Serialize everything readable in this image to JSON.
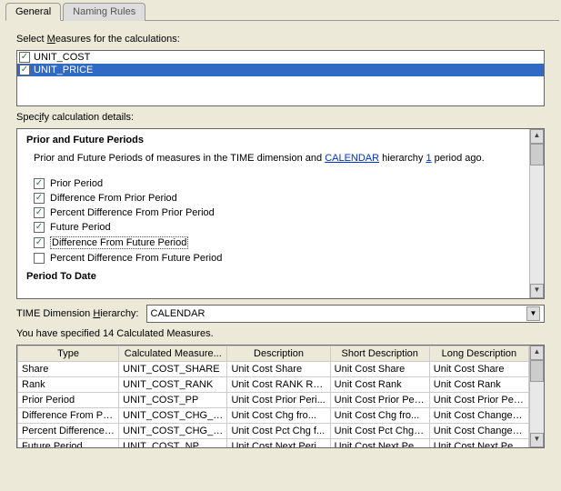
{
  "tabs": {
    "general": "General",
    "naming": "Naming Rules"
  },
  "labels": {
    "select_measures_pre": "Select ",
    "select_measures_u": "M",
    "select_measures_post": "easures for the calculations:",
    "specify_pre": "Spec",
    "specify_u": "i",
    "specify_post": "fy calculation details:",
    "dim_pre": "TIME Dimension ",
    "dim_u": "H",
    "dim_post": "ierarchy:",
    "summary": "You have specified 14 Calculated Measures."
  },
  "measures": [
    {
      "label": "UNIT_COST",
      "checked": true,
      "selected": false
    },
    {
      "label": "UNIT_PRICE",
      "checked": true,
      "selected": true
    }
  ],
  "section": {
    "title": "Prior and Future Periods",
    "text_pre": "Prior and Future Periods of measures in the  TIME  dimension and   ",
    "link1": "CALENDAR",
    "text_mid": "  hierarchy   ",
    "link2": "1",
    "text_post": " period ago.",
    "cut": "Period To Date"
  },
  "checks": [
    {
      "label": "Prior Period",
      "checked": true,
      "focused": false
    },
    {
      "label": "Difference From Prior Period",
      "checked": true,
      "focused": false
    },
    {
      "label": "Percent Difference From Prior Period",
      "checked": true,
      "focused": false
    },
    {
      "label": "Future Period",
      "checked": true,
      "focused": false
    },
    {
      "label": "Difference From Future Period",
      "checked": true,
      "focused": true
    },
    {
      "label": "Percent Difference From Future Period",
      "checked": false,
      "focused": false
    }
  ],
  "select": {
    "value": "CALENDAR"
  },
  "table": {
    "headers": [
      "Type",
      "Calculated Measure...",
      "Description",
      "Short Description",
      "Long Description"
    ],
    "rows": [
      [
        "Share",
        "UNIT_COST_SHARE",
        "Unit Cost Share",
        "Unit Cost Share",
        "Unit Cost Share"
      ],
      [
        "Rank",
        "UNIT_COST_RANK",
        "Unit Cost RANK Rank",
        "Unit Cost Rank",
        "Unit Cost Rank"
      ],
      [
        "Prior Period",
        "UNIT_COST_PP",
        "Unit Cost Prior Peri...",
        "Unit Cost Prior Peri...",
        "Unit Cost Prior Peri..."
      ],
      [
        "Difference From Pri...",
        "UNIT_COST_CHG_PP",
        "Unit Cost Chg fro...",
        "Unit Cost Chg fro...",
        "Unit Cost Change f..."
      ],
      [
        "Percent Difference ...",
        "UNIT_COST_CHG_PP",
        "Unit Cost Pct Chg f...",
        "Unit Cost Pct Chg f...",
        "Unit Cost Change f..."
      ],
      [
        "Future Period",
        "UNIT_COST_NP",
        "Unit Cost Next Peri...",
        "Unit Cost Next Peri...",
        "Unit Cost Next Peri..."
      ]
    ]
  }
}
